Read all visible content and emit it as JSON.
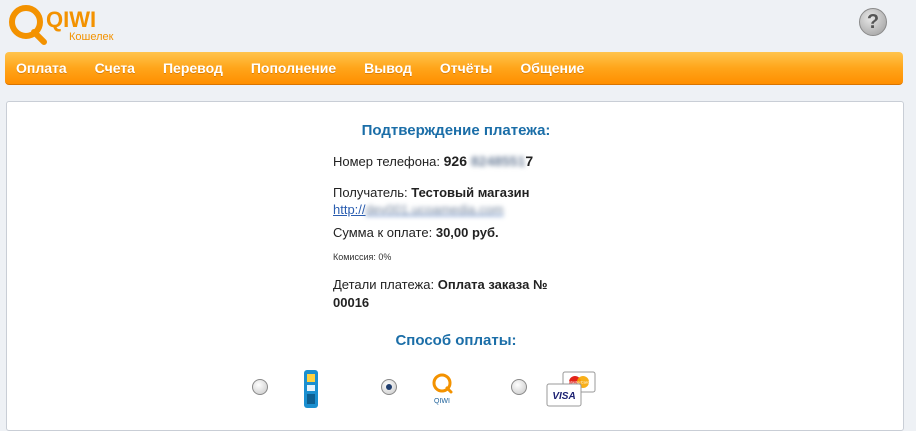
{
  "brand": {
    "name": "QIWI",
    "subtitle": "Кошелек"
  },
  "help": {
    "label": "?"
  },
  "nav": {
    "items": [
      {
        "label": "Оплата",
        "id": "payment"
      },
      {
        "label": "Счета",
        "id": "invoices"
      },
      {
        "label": "Перевод",
        "id": "transfer"
      },
      {
        "label": "Пополнение",
        "id": "topup"
      },
      {
        "label": "Вывод",
        "id": "withdraw"
      },
      {
        "label": "Отчёты",
        "id": "reports"
      },
      {
        "label": "Общение",
        "id": "messages"
      }
    ]
  },
  "confirm": {
    "title": "Подтверждение платежа:",
    "phone_label": "Номер телефона:",
    "phone_prefix": "926",
    "phone_hidden": "8248551",
    "phone_suffix": "7",
    "recipient_label": "Получатель:",
    "recipient_value": "Тестовый магазин",
    "recipient_link_prefix": "http://",
    "recipient_link_hidden": "dev001.ucoamedia.com",
    "amount_label": "Сумма к оплате:",
    "amount_value": "30,00 руб.",
    "commission": "Комиссия: 0%",
    "details_label": "Детали платежа:",
    "details_value": "Оплата заказа №",
    "details_value_2": "00016"
  },
  "payment_method": {
    "title": "Способ оплаты:",
    "options": [
      {
        "id": "terminal",
        "icon": "terminal-icon",
        "selected": false
      },
      {
        "id": "qiwi-wallet",
        "icon": "qiwi-icon",
        "label": "QIWI",
        "selected": true
      },
      {
        "id": "cards",
        "icon": "cards-icon",
        "visa": "VISA",
        "mastercard": "MasterCard",
        "selected": false
      }
    ]
  },
  "colors": {
    "accent": "#ff9a00",
    "heading": "#1b6ea8",
    "link": "#2a5db0"
  }
}
